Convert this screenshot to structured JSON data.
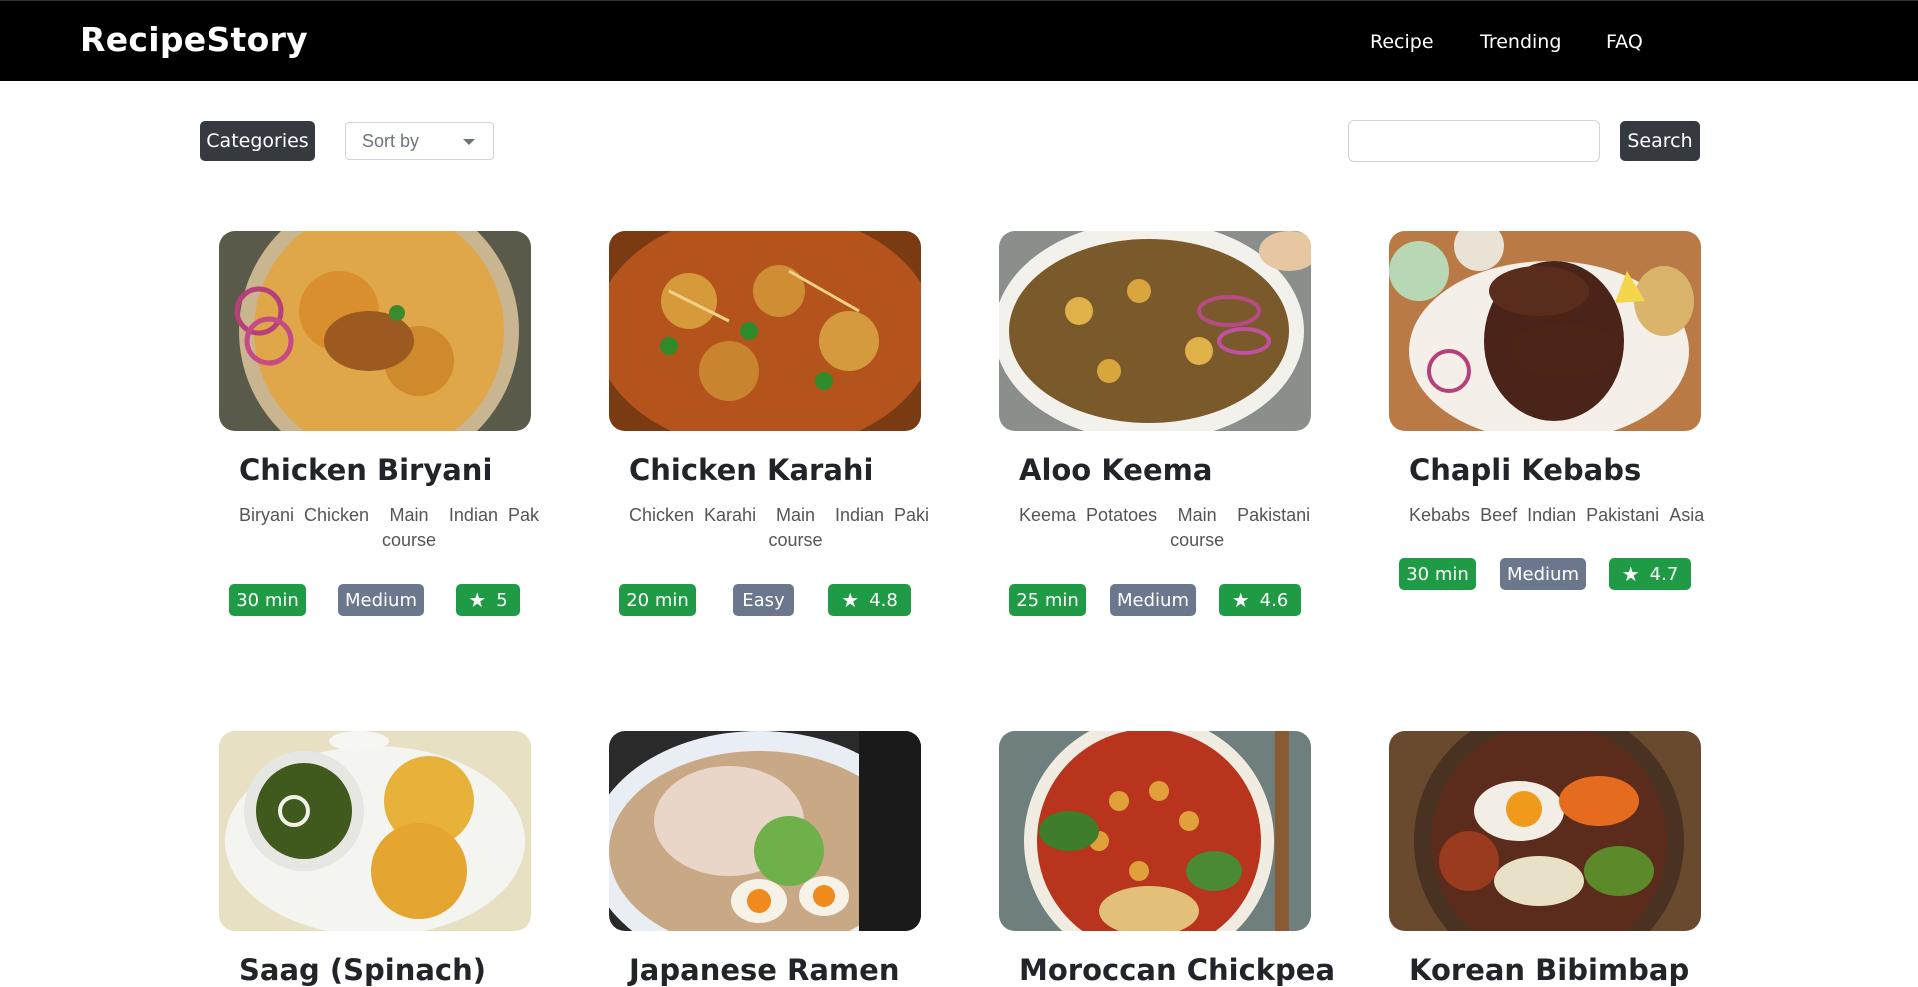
{
  "brand": "RecipeStory",
  "nav": [
    "Recipe",
    "Trending",
    "FAQ"
  ],
  "toolbar": {
    "categories_label": "Categories",
    "sort_label": "Sort by",
    "search_placeholder": "",
    "search_label": "Search"
  },
  "cards": [
    {
      "title": "Chicken Biryani",
      "tags": [
        "Biryani",
        "Chicken",
        "Main course",
        "Indian",
        "Pak"
      ],
      "time": "30 min",
      "difficulty": "Medium",
      "rating": "5"
    },
    {
      "title": "Chicken Karahi",
      "tags": [
        "Chicken",
        "Karahi",
        "Main course",
        "Indian",
        "Paki"
      ],
      "time": "20 min",
      "difficulty": "Easy",
      "rating": "4.8"
    },
    {
      "title": "Aloo Keema",
      "tags": [
        "Keema",
        "Potatoes",
        "Main course",
        "Pakistani"
      ],
      "time": "25 min",
      "difficulty": "Medium",
      "rating": "4.6"
    },
    {
      "title": "Chapli Kebabs",
      "tags": [
        "Kebabs",
        "Beef",
        "Indian",
        "Pakistani",
        "Asia"
      ],
      "time": "30 min",
      "difficulty": "Medium",
      "rating": "4.7"
    },
    {
      "title": "Saag (Spinach)"
    },
    {
      "title": "Japanese Ramen"
    },
    {
      "title": "Moroccan Chickpea"
    },
    {
      "title": "Korean Bibimbap"
    }
  ],
  "colors": {
    "nav_bg": "#000000",
    "badge_green": "#1f9b45",
    "badge_grey": "#6b778c",
    "button_dark": "#343a40"
  },
  "icons": [
    "star-icon",
    "chevron-down-icon"
  ]
}
